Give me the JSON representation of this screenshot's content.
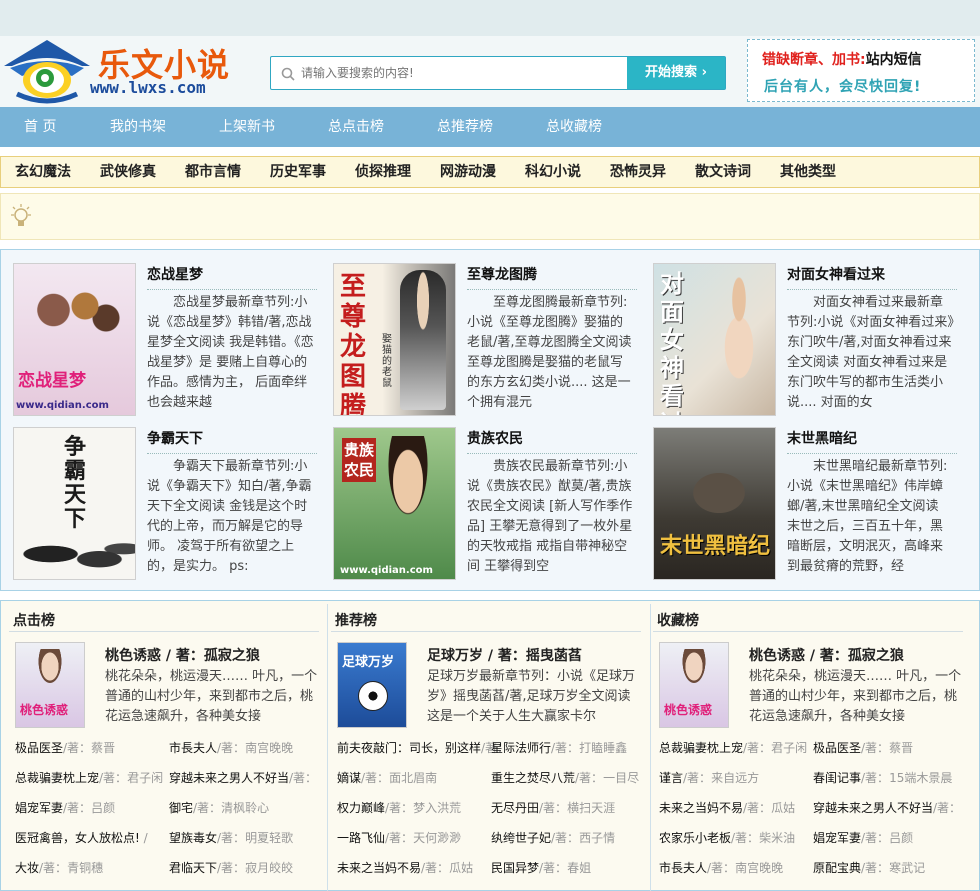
{
  "header": {
    "logo_text": "乐文小说",
    "logo_url": "www.lwxs.com",
    "search_placeholder": "请输入要搜索的内容!",
    "search_button": "开始搜索",
    "notice_red": "错缺断章、加书:",
    "notice_black": "站内短信",
    "notice_line2": "后台有人，会尽快回复!"
  },
  "nav": [
    "首 页",
    "我的书架",
    "上架新书",
    "总点击榜",
    "总推荐榜",
    "总收藏榜"
  ],
  "categories": [
    "玄幻魔法",
    "武侠修真",
    "都市言情",
    "历史军事",
    "侦探推理",
    "网游动漫",
    "科幻小说",
    "恐怖灵异",
    "散文诗词",
    "其他类型"
  ],
  "books": [
    {
      "title": "恋战星梦",
      "cover_text": "恋战星梦",
      "cover_sub": "www.qidian.com",
      "desc": "恋战星梦最新章节列:小说《恋战星梦》韩错/著,恋战星梦全文阅读 我是韩错。《恋战星梦》是 要赌上自尊心的作品。感情为主， 后面牵绊也会越来越"
    },
    {
      "title": "至尊龙图腾",
      "cover_text": "至尊龙图腾",
      "cover_sub": "娶猫的老鼠",
      "desc": "至尊龙图腾最新章节列:小说《至尊龙图腾》娶猫的老鼠/著,至尊龙图腾全文阅读 至尊龙图腾是娶猫的老鼠写的东方玄幻类小说.... 这是一个拥有混元"
    },
    {
      "title": "对面女神看过来",
      "cover_text": "对面女神看过来",
      "cover_sub": "",
      "desc": "对面女神看过来最新章节列:小说《对面女神看过来》东门吹牛/著,对面女神看过来全文阅读 对面女神看过来是东门吹牛写的都市生活类小说.... 对面的女"
    },
    {
      "title": "争霸天下",
      "cover_text": "争霸天下",
      "cover_sub": "",
      "desc": "争霸天下最新章节列:小说《争霸天下》知白/著,争霸天下全文阅读 金钱是这个时代的上帝，而万解是它的导师。 凌驾于所有欲望之上的，是实力。 ps:"
    },
    {
      "title": "贵族农民",
      "cover_text": "贵族农民",
      "cover_sub": "www.qidian.com",
      "desc": "贵族农民最新章节列:小说《贵族农民》猷莫/著,贵族农民全文阅读 [新人写作季作品] 王攀无意得到了一枚外星的天牧戒指 戒指自带神秘空间 王攀得到空"
    },
    {
      "title": "末世黑暗纪",
      "cover_text": "末世黑暗纪",
      "cover_sub": "",
      "desc": "末世黑暗纪最新章节列:小说《末世黑暗纪》伟岸蟑螂/著,末世黑暗纪全文阅读 末世之后，三百五十年，黑暗断层，文明泯灭，高峰来到最贫瘠的荒野，经"
    }
  ],
  "ranks": [
    {
      "heading": "点击榜",
      "top_title": "桃色诱惑 / 著：孤寂之狼",
      "top_desc": "桃花朵朵，桃运漫天…… 叶凡，一个普通的山村少年，来到都市之后，桃花运急速飙升，各种美女接",
      "list": [
        [
          "极品医圣",
          "/著：",
          "蔡晋"
        ],
        [
          "市長夫人",
          "/著：",
          "南宫晚晚"
        ],
        [
          "总裁骗妻枕上宠",
          "/著：",
          "君子闲"
        ],
        [
          "穿越未来之男人不好当",
          "/著：",
          ""
        ],
        [
          "娼宠军妻",
          "/著：",
          "吕颜"
        ],
        [
          "御宅",
          "/著：",
          "清枫聆心"
        ],
        [
          "医冠禽兽，女人放松点! ",
          "/",
          ""
        ],
        [
          "望族毒女",
          "/著：",
          "明夏轻歌"
        ],
        [
          "大妆",
          "/著：",
          "青铜穗"
        ],
        [
          "君临天下",
          "/著：",
          "寂月皎皎"
        ]
      ]
    },
    {
      "heading": "推荐榜",
      "top_title": "足球万岁 / 著：摇曳菡萏",
      "top_desc": "足球万岁最新章节列：小说《足球万岁》摇曳菡萏/著,足球万岁全文阅读 这是一个关于人生大赢家卡尔",
      "cover_text": "足球万岁",
      "list": [
        [
          "前夫夜敲门：司长，别这样",
          "/著：",
          ""
        ],
        [
          "星际法师行",
          "/著：",
          "打瞌睡鑫"
        ],
        [
          "嫡谋",
          "/著：",
          "面北眉南"
        ],
        [
          "重生之焚尽八荒",
          "/著：",
          "一目尽"
        ],
        [
          "权力巅峰",
          "/著：",
          "梦入洪荒"
        ],
        [
          "无尽丹田",
          "/著：",
          "横扫天涯"
        ],
        [
          "一路飞仙",
          "/著：",
          "天何渺渺"
        ],
        [
          "纨绔世子妃",
          "/著：",
          "西子情"
        ],
        [
          "未来之当妈不易",
          "/著：",
          "瓜姑"
        ],
        [
          "民国异梦",
          "/著：",
          "春姐"
        ]
      ]
    },
    {
      "heading": "收藏榜",
      "top_title": "桃色诱惑 / 著：孤寂之狼",
      "top_desc": "桃花朵朵，桃运漫天…… 叶凡，一个普通的山村少年，来到都市之后，桃花运急速飙升，各种美女接",
      "list": [
        [
          "总裁骗妻枕上宠",
          "/著：",
          "君子闲"
        ],
        [
          "极品医圣",
          "/著：",
          "蔡晋"
        ],
        [
          "谨言",
          "/著：",
          "来自远方"
        ],
        [
          "春闺记事",
          "/著：",
          "15端木景晨"
        ],
        [
          "未来之当妈不易",
          "/著：",
          "瓜姑"
        ],
        [
          "穿越未来之男人不好当",
          "/著：",
          ""
        ],
        [
          "农家乐小老板",
          "/著：",
          "柴米油"
        ],
        [
          "娼宠军妻",
          "/著：",
          "吕颜"
        ],
        [
          "市長夫人",
          "/著：",
          "南宫晚晚"
        ],
        [
          "原配宝典",
          "/著：",
          "寒武记"
        ]
      ]
    }
  ],
  "thumb_text": "桃色诱惑",
  "colors": {
    "nav": "#78b3d7",
    "search_btn": "#2bb5c6",
    "logo_orange": "#e8590c",
    "notice_red": "#e0211d"
  }
}
